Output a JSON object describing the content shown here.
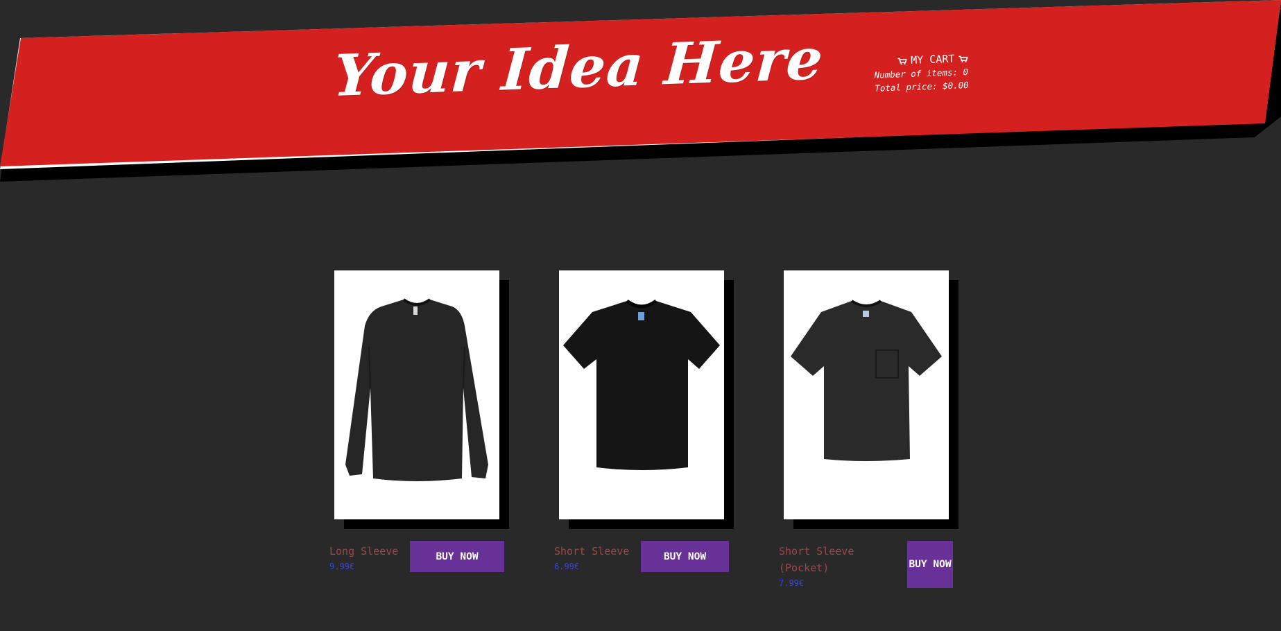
{
  "brand": {
    "title": "Your Idea Here"
  },
  "cart": {
    "heading": "MY CART",
    "icon": "cart-icon",
    "items_line": "Number of items: 0",
    "total_line": "Total price: $0.00"
  },
  "colors": {
    "background": "#292929",
    "banner_red": "#d42120",
    "name_text": "#9d4848",
    "price_text": "#3c44d6",
    "button": "#673197"
  },
  "products": [
    {
      "name": "Long Sleeve",
      "price": "9.99€",
      "button_label": "BUY NOW",
      "image": "long-sleeve-black-tshirt"
    },
    {
      "name": "Short Sleeve",
      "price": "6.99€",
      "button_label": "BUY NOW",
      "image": "short-sleeve-black-tshirt"
    },
    {
      "name": "Short Sleeve (Pocket)",
      "price": "7.99€",
      "button_label": "BUY NOW",
      "image": "short-sleeve-pocket-black-tshirt"
    }
  ]
}
